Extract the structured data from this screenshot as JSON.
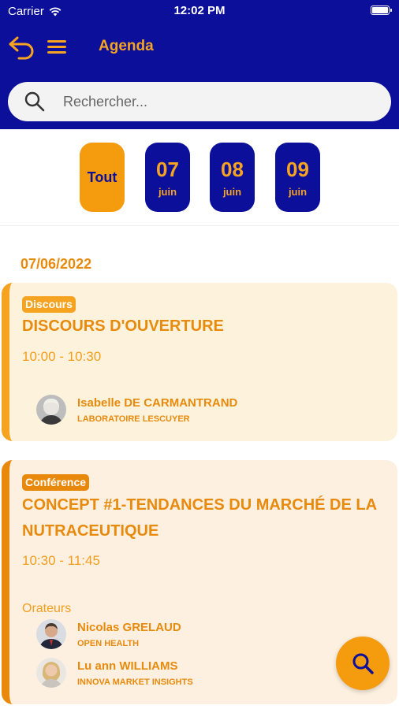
{
  "status_bar": {
    "carrier": "Carrier",
    "time": "12:02 PM"
  },
  "header": {
    "title": "Agenda"
  },
  "search": {
    "placeholder": "Rechercher..."
  },
  "date_filter": {
    "all_label": "Tout",
    "days": [
      {
        "day": "07",
        "month": "juin"
      },
      {
        "day": "08",
        "month": "juin"
      },
      {
        "day": "09",
        "month": "juin"
      }
    ]
  },
  "agenda": {
    "date": "07/06/2022",
    "sessions": [
      {
        "type": "Discours",
        "title": "DISCOURS D'OUVERTURE",
        "time": "10:00 - 10:30",
        "speakers": [
          {
            "name": "Isabelle DE CARMANTRAND",
            "organization": "LABORATOIRE LESCUYER"
          }
        ]
      },
      {
        "type": "Conférence",
        "title": "CONCEPT #1-TENDANCES DU MARCHÉ DE LA NUTRACEUTIQUE",
        "time": "10:30 - 11:45",
        "speakers_label": "Orateurs",
        "speakers": [
          {
            "name": "Nicolas GRELAUD",
            "organization": "OPEN HEALTH"
          },
          {
            "name": "Lu ann WILLIAMS",
            "organization": "INNOVA MARKET INSIGHTS"
          }
        ]
      }
    ]
  },
  "colors": {
    "primary": "#0c0f99",
    "accent": "#f59b0e",
    "text_accent": "#e88a0c"
  },
  "icons": {
    "back": "back-arrow-icon",
    "menu": "hamburger-icon",
    "search": "search-icon",
    "fab": "search-icon"
  }
}
